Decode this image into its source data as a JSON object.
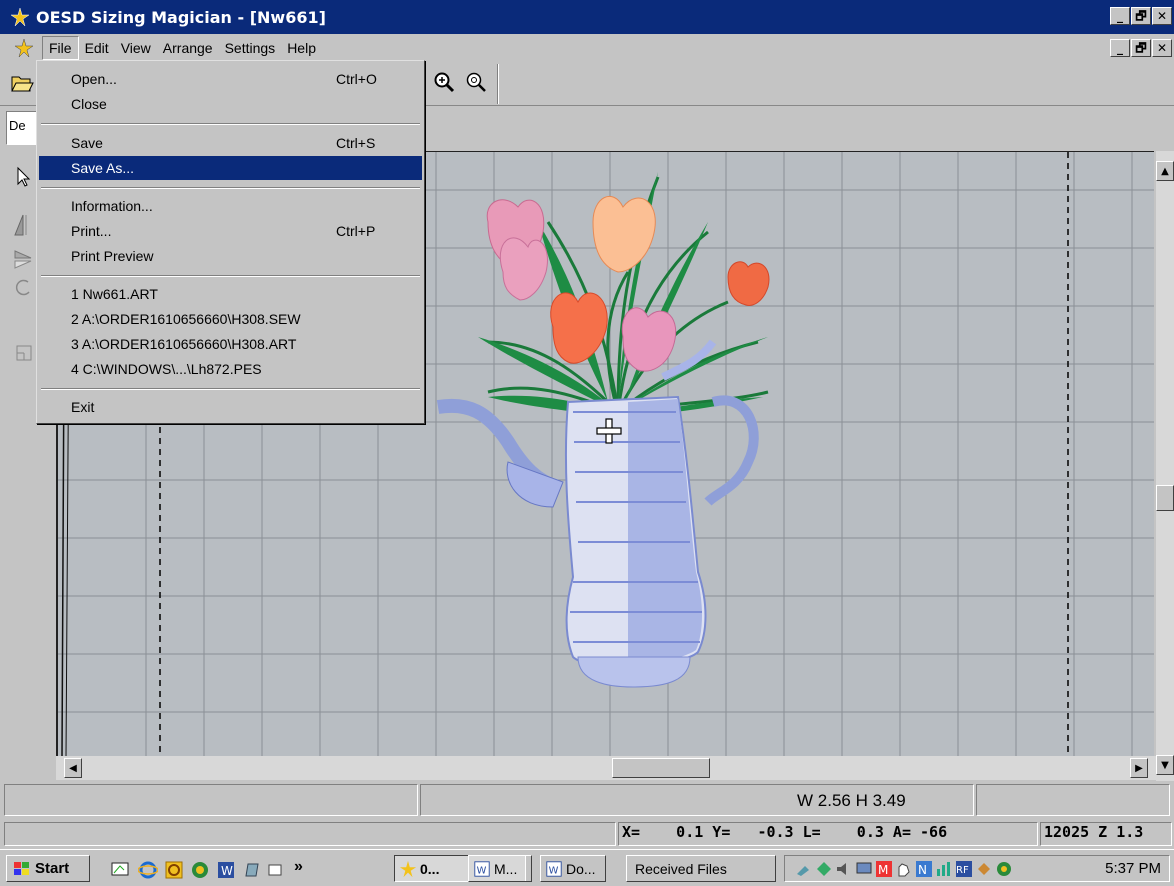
{
  "window": {
    "title": "OESD Sizing Magician - [Nw661]",
    "min_glyph": "_",
    "max_glyph": "🗗",
    "close_glyph": "✕"
  },
  "menubar": {
    "items": [
      "File",
      "Edit",
      "View",
      "Arrange",
      "Settings",
      "Help"
    ]
  },
  "toolbar2": {
    "mode_label": "De"
  },
  "file_menu": {
    "open": "Open...",
    "open_shortcut": "Ctrl+O",
    "close": "Close",
    "save": "Save",
    "save_shortcut": "Ctrl+S",
    "save_as": "Save As...",
    "information": "Information...",
    "print": "Print...",
    "print_shortcut": "Ctrl+P",
    "print_preview": "Print Preview",
    "recent": [
      "1 Nw661.ART",
      "2 A:\\ORDER1610656660\\H308.SEW",
      "3 A:\\ORDER1610656660\\H308.ART",
      "4 C:\\WINDOWS\\...\\Lh872.PES"
    ],
    "exit": "Exit"
  },
  "status": {
    "size": "W 2.56 H 3.49",
    "coords": "X=    0.1 Y=   -0.3 L=    0.3 A= -66",
    "stitch": "12025 Z 1.3"
  },
  "taskbar": {
    "start": "Start",
    "chevron": "»",
    "tasks": [
      "0...",
      "M...",
      "Do...",
      "Received Files"
    ],
    "clock": "5:37 PM"
  },
  "colors": {
    "titlebar": "#0a2a7a",
    "menu_highlight": "#0a2a7a",
    "chrome": "#c4c4c4",
    "canvas": "#b8bdc2"
  }
}
